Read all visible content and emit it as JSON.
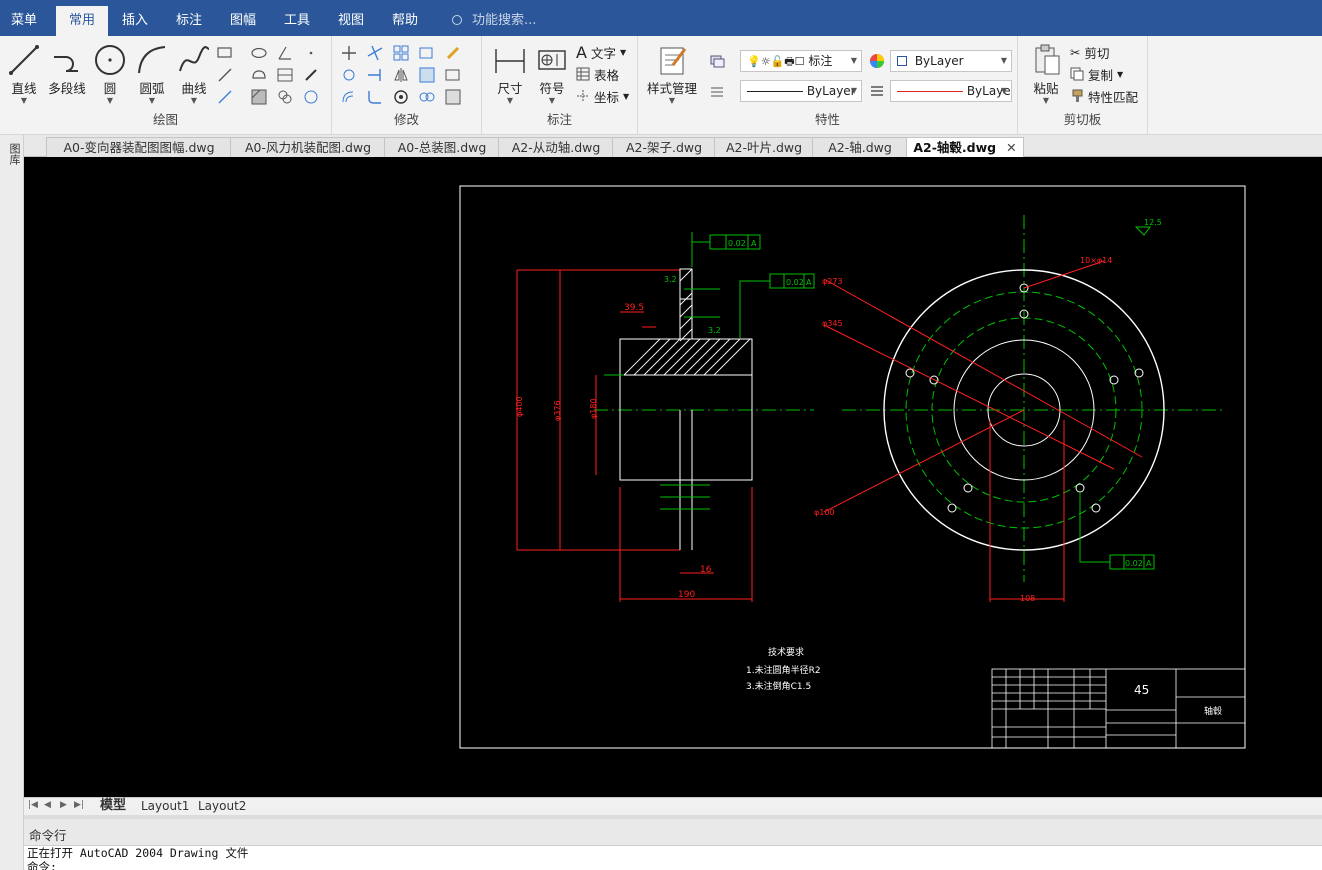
{
  "menu": {
    "items": [
      "菜单",
      "常用",
      "插入",
      "标注",
      "图幅",
      "工具",
      "视图",
      "帮助"
    ],
    "active": "常用",
    "search_placeholder": "功能搜索..."
  },
  "ribbon": {
    "draw": {
      "label": "绘图",
      "buttons": [
        "直线",
        "多段线",
        "圆",
        "圆弧",
        "曲线"
      ]
    },
    "modify": {
      "label": "修改"
    },
    "annotate": {
      "label": "标注",
      "dimension": "尺寸",
      "symbol": "符号",
      "text": "文字",
      "table": "表格",
      "coordinate": "坐标"
    },
    "properties": {
      "label": "特性",
      "style_manager": "样式管理",
      "layer_name": "标注",
      "color_value": "ByLayer",
      "linetype_value": "ByLayer",
      "lineweight_value": "ByLaye"
    },
    "clipboard": {
      "label": "剪切板",
      "paste": "粘贴",
      "cut": "剪切",
      "copy": "复制",
      "match": "特性匹配"
    }
  },
  "side_palette": {
    "label": "图库"
  },
  "tabs": [
    "A0-变向器装配图图幅.dwg",
    "A0-风力机装配图.dwg",
    "A0-总装图.dwg",
    "A2-从动轴.dwg",
    "A2-架子.dwg",
    "A2-叶片.dwg",
    "A2-轴.dwg",
    "A2-轴毂.dwg"
  ],
  "active_tab": "A2-轴毂.dwg",
  "drawing": {
    "tolerance_1": "0.02",
    "tolerance_2": "0.02",
    "tolerance_3": "0.02",
    "datum": "A",
    "dim_39_5": "39.5",
    "dim_190": "190",
    "dim_16": "16",
    "dim_108": "108",
    "dim_phi273": "φ273",
    "dim_phi345": "φ345",
    "dim_phi100": "φ100",
    "dim_holes": "10×φ14",
    "roughness_top": "12.5",
    "material": "45",
    "notes_title": "技术要求",
    "note_1": "1.未注圆角半径R2",
    "note_2": "3.未注倒角C1.5",
    "part_name": "轴毂"
  },
  "layout_tabs": [
    "模型",
    "Layout1",
    "Layout2"
  ],
  "active_layout": "模型",
  "command": {
    "header": "命令行",
    "lines": [
      "正在打开 AutoCAD 2004 Drawing 文件",
      "命令:"
    ]
  }
}
